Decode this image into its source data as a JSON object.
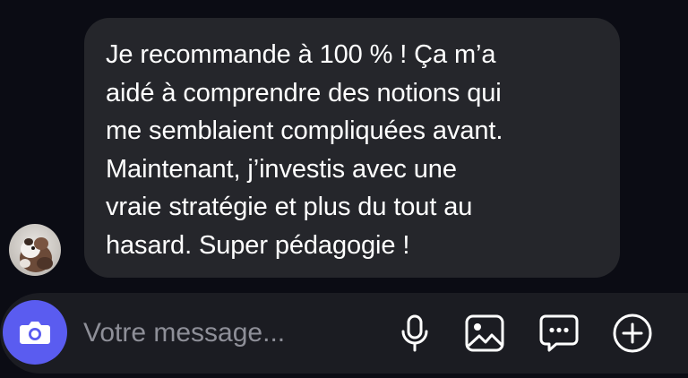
{
  "message": {
    "text": "Je recommande à 100 % ! Ça m’a\naidé à comprendre des notions qui\nme semblaient compliquées avant.\nMaintenant, j’investis avec une\nvraie stratégie et plus du tout au\nhasard. Super pédagogie !"
  },
  "composer": {
    "placeholder": "Votre message...",
    "value": ""
  },
  "icons": {
    "camera": "camera-icon",
    "microphone": "microphone-icon",
    "gallery": "image-icon",
    "sticker": "chat-bubble-dots-icon",
    "more": "plus-circle-icon"
  },
  "colors": {
    "background": "#0b0c14",
    "bubble": "#25262b",
    "composer": "#1b1c22",
    "accent": "#5a5cf0",
    "placeholder": "#8e8f98"
  }
}
